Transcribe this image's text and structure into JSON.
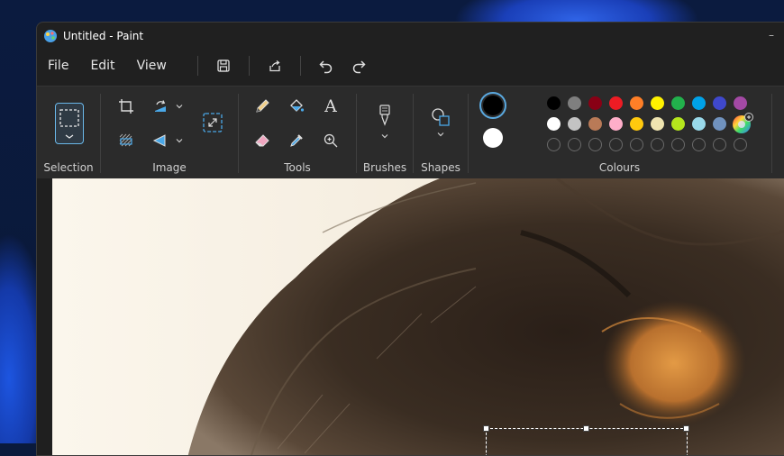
{
  "window": {
    "title": "Untitled - Paint",
    "minimize_glyph": "–"
  },
  "menu": {
    "file": "File",
    "edit": "Edit",
    "view": "View"
  },
  "quick_access": {
    "icons": [
      "save-icon",
      "share-icon",
      "undo-icon",
      "redo-icon"
    ]
  },
  "ribbon": {
    "selection": "Selection",
    "image": "Image",
    "tools": "Tools",
    "brushes": "Brushes",
    "shapes": "Shapes",
    "colours": "Colours"
  },
  "text_tool_glyph": "A",
  "colours": {
    "primary": "#000000",
    "secondary": "#ffffff",
    "row1": [
      "#000000",
      "#7f7f7f",
      "#880015",
      "#ed1c24",
      "#ff7f27",
      "#fff200",
      "#22b14c",
      "#00a2e8",
      "#3f48cc",
      "#a349a4"
    ],
    "row2": [
      "#ffffff",
      "#c3c3c3",
      "#b97a57",
      "#ffaec9",
      "#ffc90e",
      "#efe4b0",
      "#b5e61d",
      "#99d9ea",
      "#7092be",
      "#c8bfe7"
    ],
    "row3_empty_count": 10
  }
}
